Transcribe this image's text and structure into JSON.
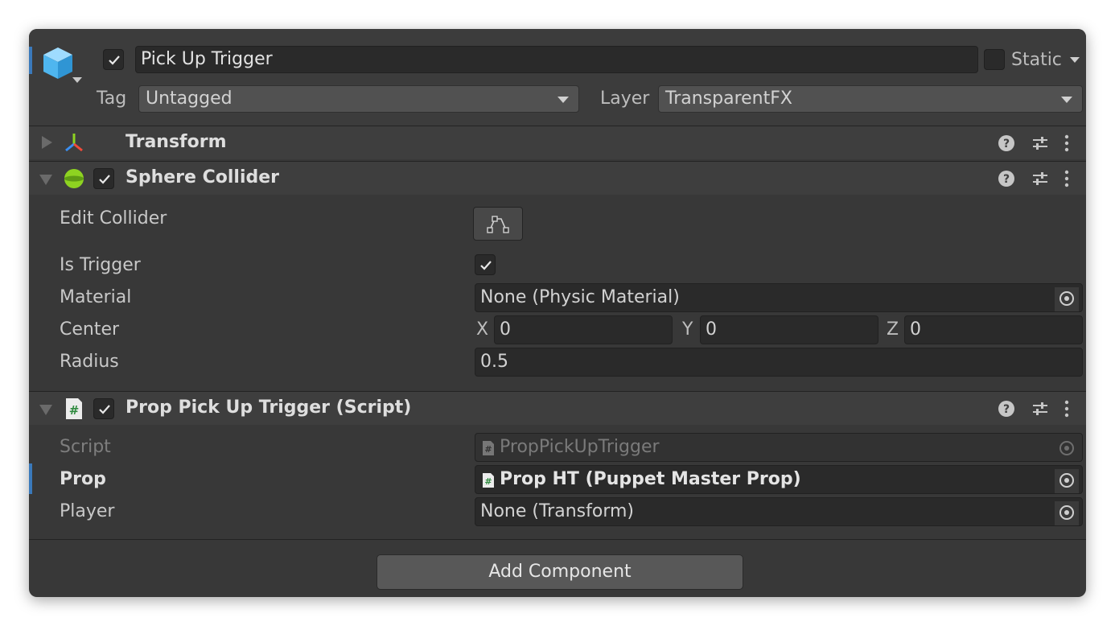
{
  "header": {
    "object_name": "Pick Up Trigger",
    "active_checked": true,
    "static_label": "Static",
    "static_checked": false,
    "tag_label": "Tag",
    "tag_value": "Untagged",
    "layer_label": "Layer",
    "layer_value": "TransparentFX"
  },
  "transform": {
    "title": "Transform",
    "expanded": false
  },
  "sphere_collider": {
    "title": "Sphere Collider",
    "enabled": true,
    "edit_collider_label": "Edit Collider",
    "is_trigger_label": "Is Trigger",
    "is_trigger": true,
    "material_label": "Material",
    "material_value": "None (Physic Material)",
    "center_label": "Center",
    "center": {
      "x_label": "X",
      "x": "0",
      "y_label": "Y",
      "y": "0",
      "z_label": "Z",
      "z": "0"
    },
    "radius_label": "Radius",
    "radius_value": "0.5"
  },
  "script_component": {
    "title": "Prop Pick Up Trigger (Script)",
    "enabled": true,
    "script_label": "Script",
    "script_value": "PropPickUpTrigger",
    "prop_label": "Prop",
    "prop_value": "Prop HT (Puppet Master Prop)",
    "player_label": "Player",
    "player_value": "None (Transform)"
  },
  "footer": {
    "add_component_label": "Add Component"
  },
  "colors": {
    "window_bg": "#383838",
    "field_bg": "#2a2a2a",
    "accent_blue": "#3a79bb",
    "collider_green": "#8ed321",
    "text": "#d2d2d2"
  },
  "icons": [
    "cube-icon",
    "transform-axes-icon",
    "sphere-collider-icon",
    "script-hash-icon",
    "help-icon",
    "presets-sliders-icon",
    "more-vert-icon",
    "object-picker-icon",
    "edit-collider-icon",
    "checkmark-icon",
    "dropdown-arrow-icon"
  ]
}
